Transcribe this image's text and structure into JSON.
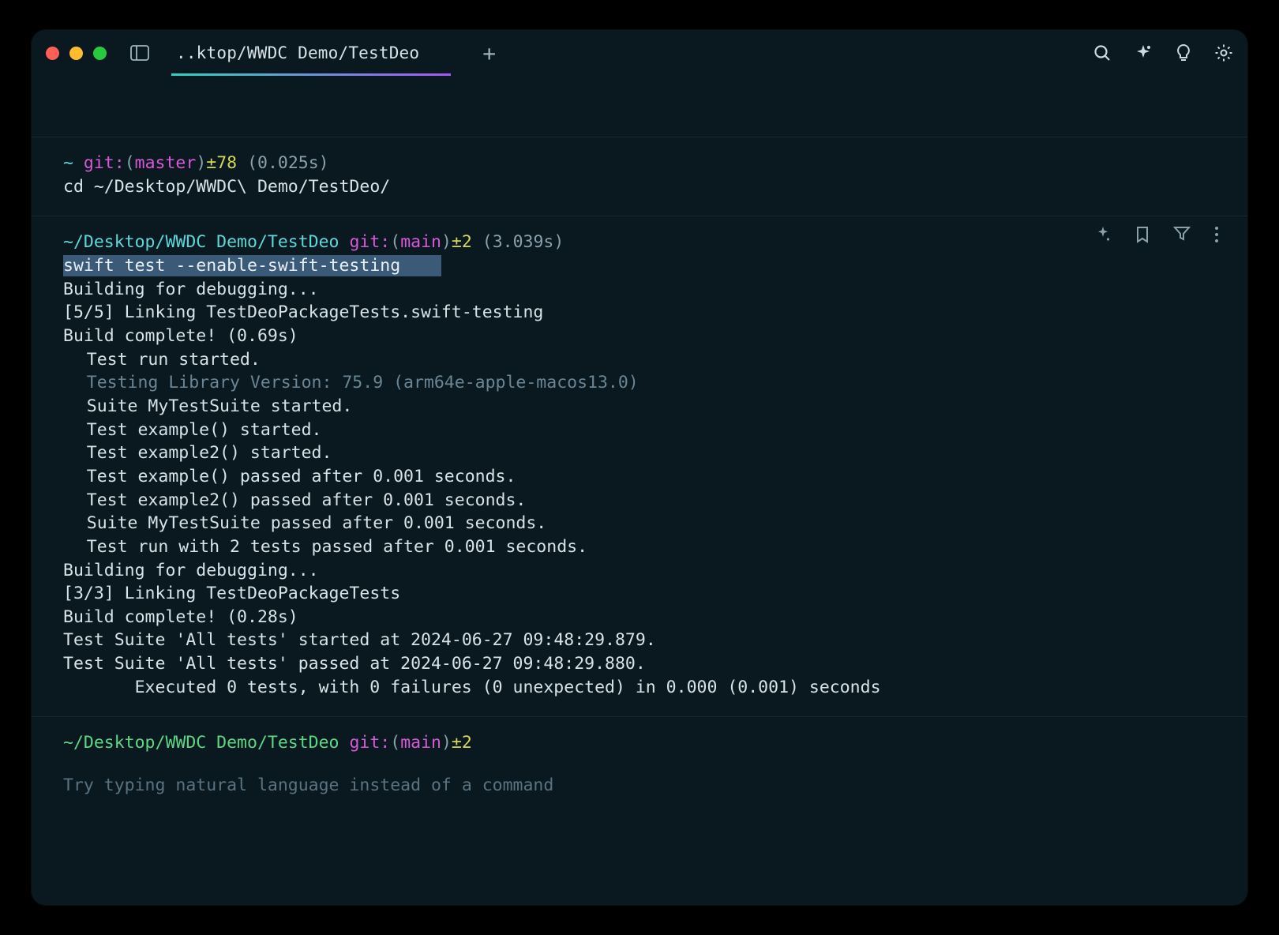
{
  "tab": {
    "title": "..ktop/WWDC Demo/TestDeo"
  },
  "block1": {
    "prompt": {
      "tilde": "~",
      "git_label": "git:",
      "branch": "master",
      "delta": "±78",
      "timing": "(0.025s)"
    },
    "command": "cd ~/Desktop/WWDC\\ Demo/TestDeo/"
  },
  "block2": {
    "prompt": {
      "path": "~/Desktop/WWDC Demo/TestDeo",
      "git_label": "git:",
      "branch": "main",
      "delta": "±2",
      "timing": "(3.039s)"
    },
    "command": "swift test --enable-swift-testing",
    "out": {
      "l1": "Building for debugging...",
      "l2": "[5/5] Linking TestDeoPackageTests.swift-testing",
      "l3": "Build complete! (0.69s)",
      "l4": "Test run started.",
      "l5": "Testing Library Version: 75.9 (arm64e-apple-macos13.0)",
      "l6": "Suite MyTestSuite started.",
      "l7": "Test example() started.",
      "l8": "Test example2() started.",
      "l9": "Test example() passed after 0.001 seconds.",
      "l10": "Test example2() passed after 0.001 seconds.",
      "l11": "Suite MyTestSuite passed after 0.001 seconds.",
      "l12": "Test run with 2 tests passed after 0.001 seconds.",
      "l13": "Building for debugging...",
      "l14": "[3/3] Linking TestDeoPackageTests",
      "l15": "Build complete! (0.28s)",
      "l16": "Test Suite 'All tests' started at 2024-06-27 09:48:29.879.",
      "l17": "Test Suite 'All tests' passed at 2024-06-27 09:48:29.880.",
      "l18": "Executed 0 tests, with 0 failures (0 unexpected) in 0.000 (0.001) seconds"
    }
  },
  "input": {
    "prompt": {
      "path": "~/Desktop/WWDC Demo/TestDeo",
      "git_label": "git:",
      "branch": "main",
      "delta": "±2"
    },
    "placeholder": "Try typing natural language instead of a command"
  }
}
